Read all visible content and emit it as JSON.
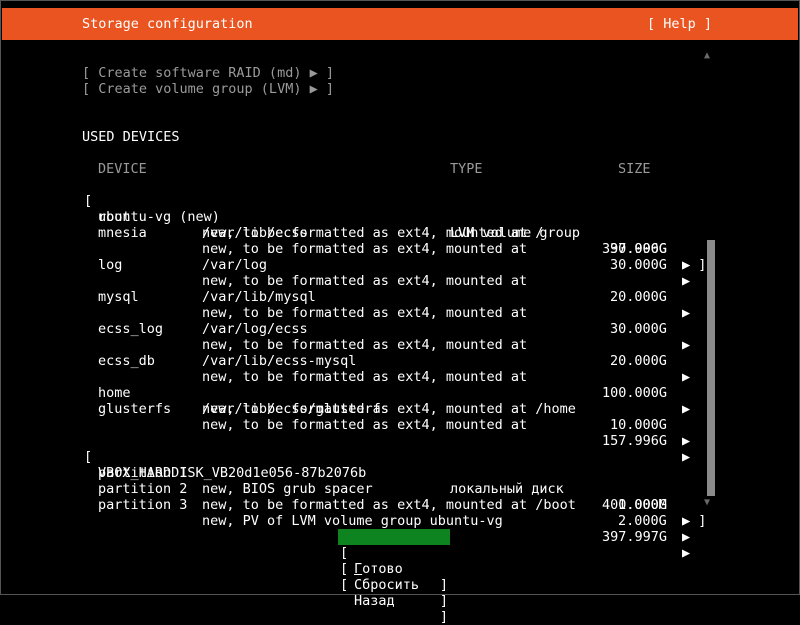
{
  "header": {
    "title": "Storage configuration",
    "help_label": "[ Help ]"
  },
  "actions": {
    "create_raid": "[ Create software RAID (md) ▶ ]",
    "create_vg": "[ Create volume group (LVM) ▶ ]"
  },
  "used_devices": {
    "heading": "USED DEVICES",
    "columns": {
      "device": "DEVICE",
      "type": "TYPE",
      "size": "SIZE"
    }
  },
  "vg": {
    "open_bracket": "[",
    "name": "ubuntu-vg (new)",
    "type": "LVM volume group",
    "size": "397.996G",
    "arrow": "▶ ]",
    "volumes": [
      {
        "name": "root",
        "desc": "new, to be formatted as ext4, mounted at /",
        "desc2": "",
        "size": "30.000G",
        "arrow": "▶"
      },
      {
        "name": "mnesia",
        "desc": "new, to be formatted as ext4, mounted at",
        "desc2": "/var/lib/ecss",
        "size": "30.000G",
        "arrow": "▶"
      },
      {
        "name": "log",
        "desc": "new, to be formatted as ext4, mounted at",
        "desc2": "/var/log",
        "size": "20.000G",
        "arrow": "▶"
      },
      {
        "name": "mysql",
        "desc": "new, to be formatted as ext4, mounted at",
        "desc2": "/var/lib/mysql",
        "size": "30.000G",
        "arrow": "▶"
      },
      {
        "name": "ecss_log",
        "desc": "new, to be formatted as ext4, mounted at",
        "desc2": "/var/log/ecss",
        "size": "20.000G",
        "arrow": "▶"
      },
      {
        "name": "ecss_db",
        "desc": "new, to be formatted as ext4, mounted at",
        "desc2": "/var/lib/ecss-mysql",
        "size": "100.000G",
        "arrow": "▶"
      },
      {
        "name": "home",
        "desc": "new, to be formatted as ext4, mounted at /home",
        "desc2": "",
        "size": "10.000G",
        "arrow": "▶"
      },
      {
        "name": "glusterfs",
        "desc": "new, to be formatted as ext4, mounted at",
        "desc2": "/var/lib/ecss/glusterfs",
        "size": "157.996G",
        "arrow": "▶"
      }
    ]
  },
  "disk": {
    "open_bracket": "[",
    "name": "VBOX_HARDDISK_VB20d1e056-87b2076b",
    "type": "локальный диск",
    "size": "400.000G",
    "arrow": "▶ ]",
    "partitions": [
      {
        "name": "partition 1",
        "desc": "new, BIOS grub spacer",
        "size": "1.000M",
        "arrow": "▶"
      },
      {
        "name": "partition 2",
        "desc": "new, to be formatted as ext4, mounted at /boot",
        "size": "2.000G",
        "arrow": "▶"
      },
      {
        "name": "partition 3",
        "desc": "new, PV of LVM volume group ubuntu-vg",
        "size": "397.997G",
        "arrow": "▶"
      }
    ]
  },
  "buttons": {
    "done": {
      "accel": "Г",
      "rest": "отово"
    },
    "reset": "Сбросить",
    "back": "Назад"
  },
  "scroll": {
    "up": "▲",
    "down": "▼"
  },
  "colors": {
    "title_bar": "#e95420",
    "focused_button": "#0e8420",
    "dimmed_text": "#9a9a9a"
  }
}
